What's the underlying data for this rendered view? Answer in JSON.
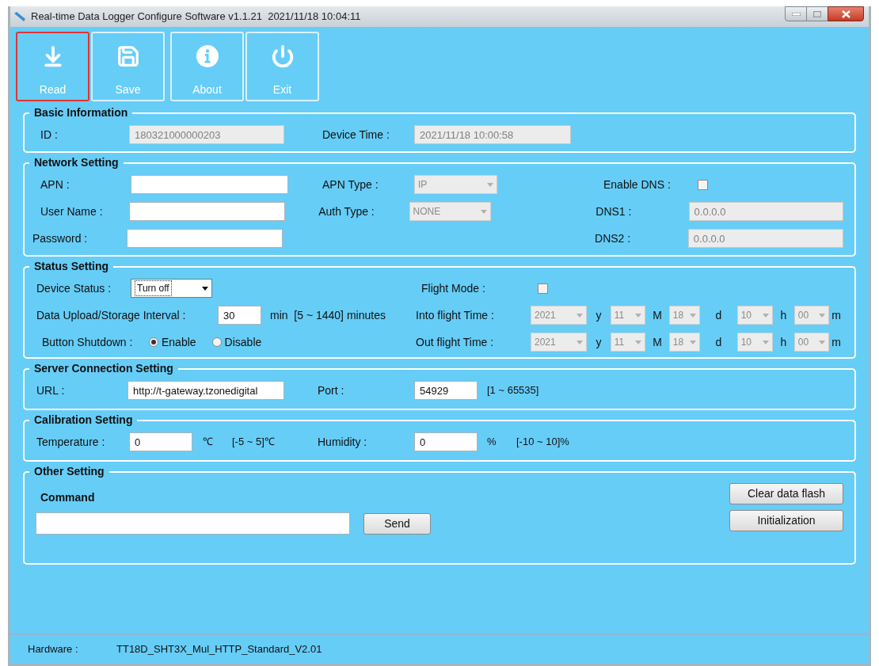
{
  "window": {
    "title": "Real-time Data Logger Configure Software v1.1.21  2021/11/18 10:04:11"
  },
  "toolbar": [
    {
      "label": "Read",
      "kind": "download",
      "selected": true
    },
    {
      "label": "Save",
      "kind": "save",
      "selected": false
    },
    {
      "label": "About",
      "kind": "info",
      "selected": false
    },
    {
      "label": "Exit",
      "kind": "power",
      "selected": false
    }
  ],
  "basic_information": {
    "title": "Basic Information",
    "id_label": "ID :",
    "id": {
      "value": "180321000000203",
      "disabled": true
    },
    "device_time_label": "Device Time :",
    "device_time": {
      "value": "2021/11/18 10:00:58",
      "disabled": true
    }
  },
  "network_setting": {
    "title": "Network Setting",
    "apn_label": "APN :",
    "apn": {
      "disabled": false
    },
    "user_name_label": "User Name :",
    "user_name": {
      "disabled": false
    },
    "password_label": "Password :",
    "password": {
      "disabled": false
    },
    "apn_type_label": "APN Type :",
    "apn_type": {
      "value": "IP",
      "disabled": true
    },
    "auth_type_label": "Auth Type :",
    "auth_type": {
      "value": "NONE",
      "disabled": true
    },
    "enable_dns_label": "Enable DNS :",
    "enable_dns": {
      "checked": false
    },
    "dns1_label": "DNS1 :",
    "dns1": {
      "value": "0.0.0.0",
      "disabled": true
    },
    "dns2_label": "DNS2 :",
    "dns2": {
      "value": "0.0.0.0",
      "disabled": true
    }
  },
  "status_setting": {
    "title": "Status Setting",
    "device_status_label": "Device Status :",
    "device_status": {
      "value": "Turn off",
      "disabled": false
    },
    "interval_label": "Data Upload/Storage Interval :",
    "interval": {
      "value": "30",
      "disabled": false
    },
    "interval_hint": "min  [5 ~ 1440] minutes",
    "button_shutdown_label": "Button Shutdown :",
    "button_shutdown": [
      {
        "label": "Enable",
        "selected": true
      },
      {
        "label": "Disable",
        "selected": false
      }
    ],
    "flight_mode_label": "Flight Mode :",
    "flight_mode": {
      "checked": false
    },
    "into_flight_label": "Into flight Time :",
    "into_flight_time": [
      {
        "value": "2021",
        "unit": "y",
        "disabled": true
      },
      {
        "value": "11",
        "unit": "M",
        "disabled": true
      },
      {
        "value": "18",
        "unit": "d",
        "disabled": true
      },
      {
        "value": "10",
        "unit": "h",
        "disabled": true
      },
      {
        "value": "00",
        "unit": "m",
        "disabled": true
      }
    ],
    "out_flight_label": "Out flight Time :",
    "out_flight_time": [
      {
        "value": "2021",
        "unit": "y",
        "disabled": true
      },
      {
        "value": "11",
        "unit": "M",
        "disabled": true
      },
      {
        "value": "18",
        "unit": "d",
        "disabled": true
      },
      {
        "value": "10",
        "unit": "h",
        "disabled": true
      },
      {
        "value": "00",
        "unit": "m",
        "disabled": true
      }
    ]
  },
  "server_connection_setting": {
    "title": "Server Connection Setting",
    "url_label": "URL :",
    "url": {
      "value": "http://t-gateway.tzonedigital",
      "disabled": false
    },
    "port_label": "Port :",
    "port": {
      "value": "54929",
      "disabled": false
    },
    "port_hint": "[1 ~ 65535]"
  },
  "calibration_setting": {
    "title": "Calibration Setting",
    "temperature_label": "Temperature :",
    "temperature": {
      "value": "0",
      "disabled": false
    },
    "temperature_unit": "℃",
    "temperature_range": "[-5 ~ 5]℃",
    "humidity_label": "Humidity :",
    "humidity": {
      "value": "0",
      "disabled": false
    },
    "humidity_unit": "%",
    "humidity_range": "[-10 ~ 10]%"
  },
  "other_setting": {
    "title": "Other Setting",
    "command_label": "Command",
    "command": {
      "disabled": false
    },
    "send": "Send",
    "buttons": [
      "Clear data flash",
      "Initialization"
    ]
  },
  "status_bar": {
    "hardware_label": "Hardware :",
    "hardware": "TT18D_SHT3X_Mul_HTTP_Standard_V2.01"
  }
}
